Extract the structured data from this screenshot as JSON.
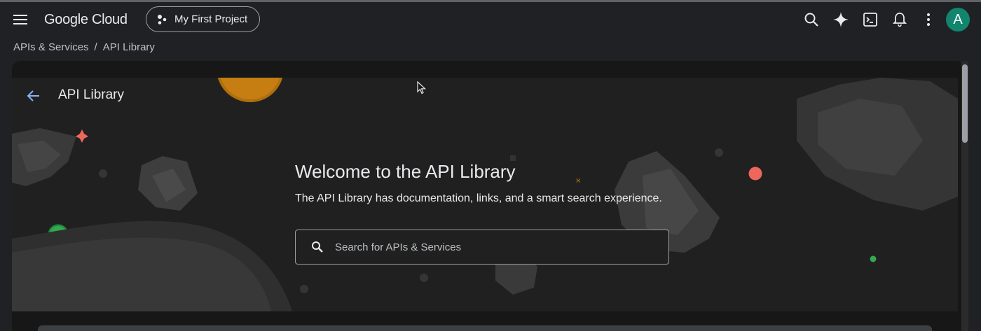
{
  "topbar": {
    "logo_text": "Google Cloud",
    "project_label": "My First Project",
    "avatar_letter": "A",
    "icons": [
      "menu-icon",
      "project-icon",
      "search-icon",
      "gemini-sparkle-icon",
      "cloud-shell-icon",
      "notifications-bell-icon",
      "more-vert-icon"
    ]
  },
  "breadcrumb": {
    "items": [
      "APIs & Services",
      "API Library"
    ],
    "separator": "/"
  },
  "hero": {
    "page_title": "API Library",
    "welcome": "Welcome to the API Library",
    "subtitle": "The API Library has documentation, links, and a smart search experience."
  },
  "search": {
    "placeholder": "Search for APIs & Services",
    "value": ""
  },
  "colors": {
    "background": "#202124",
    "panel": "#171717",
    "hero": "#202020",
    "avatar": "#12856f",
    "accent_blue": "#8ab4f8"
  }
}
